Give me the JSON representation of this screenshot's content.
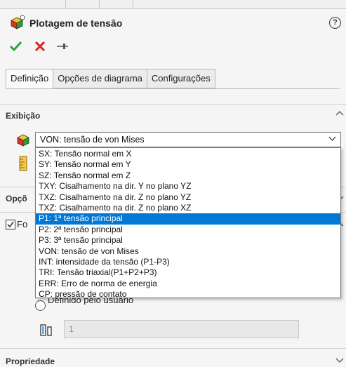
{
  "header": {
    "title": "Plotagem de tensão",
    "help_label": "?"
  },
  "tabs": [
    {
      "label": "Definição"
    },
    {
      "label": "Opções de diagrama"
    },
    {
      "label": "Configurações"
    }
  ],
  "display_section": {
    "title": "Exibição",
    "combo_value": "VON: tensão de von Mises",
    "options": [
      "SX: Tensão normal em X",
      "SY: Tensão normal em Y",
      "SZ: Tensão normal em Z",
      "TXY: Cisalhamento na dir. Y no plano YZ",
      "TXZ: Cisalhamento na dir. Z no plano YZ",
      "TXZ: Cisalhamento na dir. Z no plano XZ",
      "P1: 1ª tensão principal",
      "P2: 2ª tensão principal",
      "P3: 3ª tensão principal",
      "VON: tensão de von Mises",
      "INT: intensidade da tensão (P1-P3)",
      "TRI: Tensão triaxial(P1+P2+P3)",
      "ERR:    Erro de norma de energia",
      "CP: pressão de contato"
    ],
    "selected_option": "P1: 1ª tensão principal"
  },
  "advanced_section": {
    "title_partial": "Opçõ"
  },
  "deform_section": {
    "label_partial": "Fo"
  },
  "user_defined_label_partial": "Definido pelo usuário",
  "scale_field_value": "1",
  "property_section": {
    "title": "Propriedade"
  }
}
